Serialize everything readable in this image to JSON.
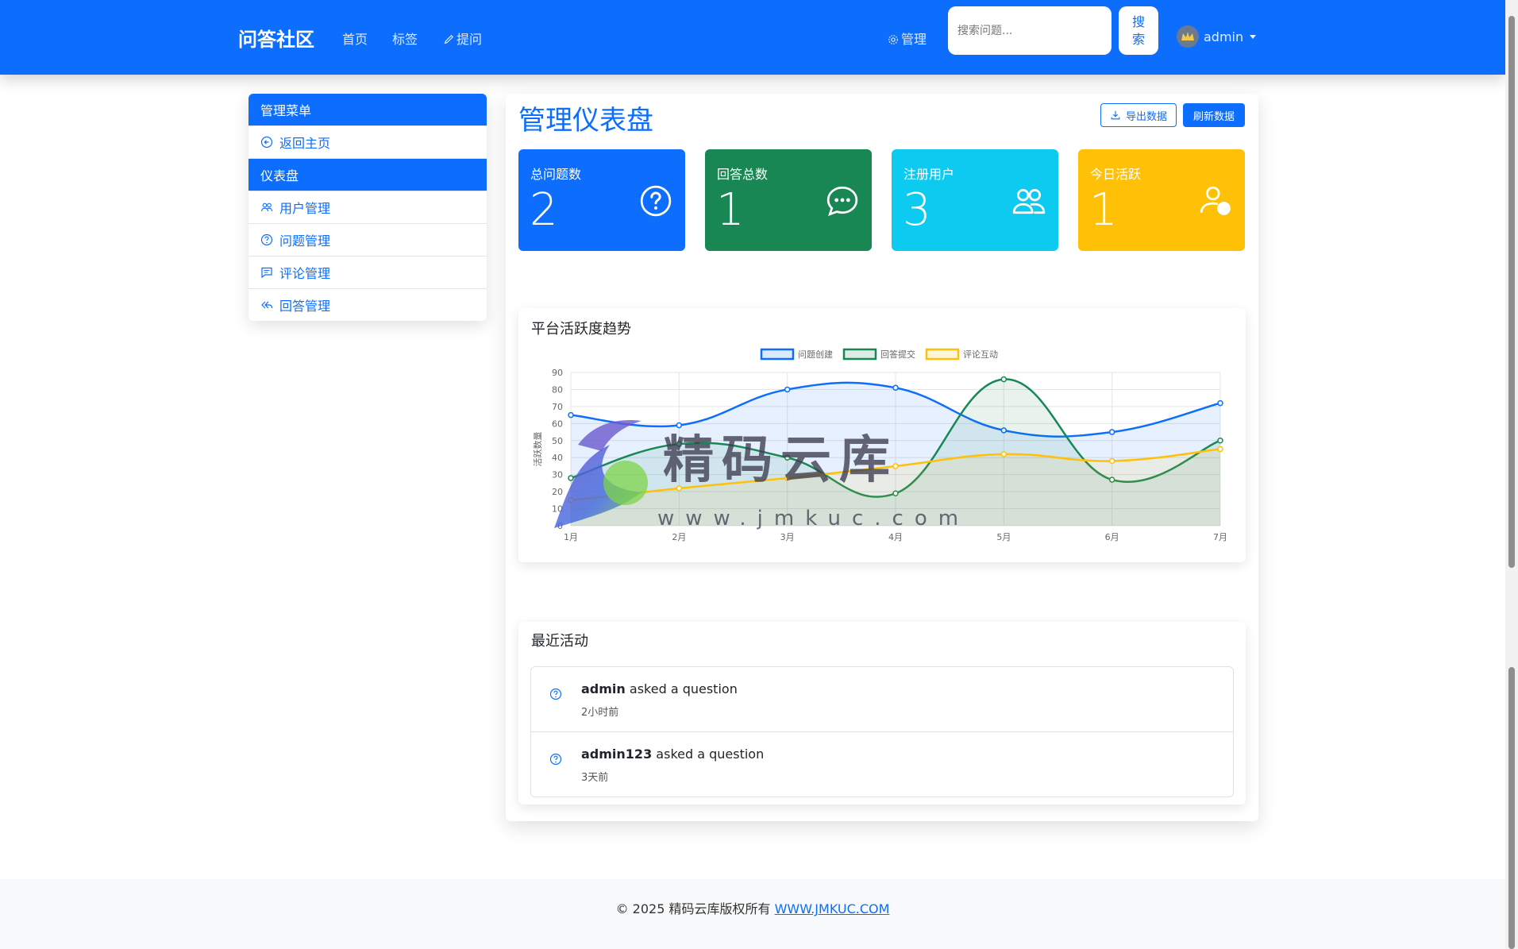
{
  "navbar": {
    "brand": "问答社区",
    "links": [
      "首页",
      "标签",
      "提问"
    ],
    "admin_link": "管理",
    "search_placeholder": "搜索问题...",
    "search_button": "搜索",
    "user": "admin"
  },
  "sidebar": {
    "header": "管理菜单",
    "items": [
      {
        "label": "返回主页",
        "icon": "arrow-left-circle-icon"
      },
      {
        "label": "仪表盘",
        "icon": "",
        "active": true
      },
      {
        "label": "用户管理",
        "icon": "people-icon"
      },
      {
        "label": "问题管理",
        "icon": "question-circle-icon"
      },
      {
        "label": "评论管理",
        "icon": "chat-square-icon"
      },
      {
        "label": "回答管理",
        "icon": "reply-all-icon"
      }
    ]
  },
  "main": {
    "title": "管理仪表盘",
    "export_button": "导出数据",
    "refresh_button": "刷新数据",
    "stats": [
      {
        "label": "总问题数",
        "value": "2",
        "color": "#0d6efd",
        "icon": "question-circle-icon"
      },
      {
        "label": "回答总数",
        "value": "1",
        "color": "#198754",
        "icon": "chat-dots-icon"
      },
      {
        "label": "注册用户",
        "value": "3",
        "color": "#0dcaf0",
        "icon": "people-icon"
      },
      {
        "label": "今日活跃",
        "value": "1",
        "color": "#ffc107",
        "icon": "person-check-icon"
      }
    ],
    "chart_title": "平台活跃度趋势",
    "activity_title": "最近活动",
    "activities": [
      {
        "user": "admin",
        "text": "asked a question",
        "time": "2小时前"
      },
      {
        "user": "admin123",
        "text": "asked a question",
        "time": "3天前"
      }
    ]
  },
  "chart_data": {
    "type": "line",
    "categories": [
      "1月",
      "2月",
      "3月",
      "4月",
      "5月",
      "6月",
      "7月"
    ],
    "series": [
      {
        "name": "问题创建",
        "color": "#0d6efd",
        "values": [
          65,
          59,
          80,
          81,
          56,
          55,
          72
        ]
      },
      {
        "name": "回答提交",
        "color": "#198754",
        "values": [
          28,
          48,
          40,
          19,
          86,
          27,
          50
        ]
      },
      {
        "name": "评论互动",
        "color": "#ffc107",
        "values": [
          15,
          22,
          28,
          35,
          42,
          38,
          45
        ]
      }
    ],
    "ylabel": "活跃数量",
    "ylim": [
      0,
      90
    ],
    "yticks": [
      0,
      10,
      20,
      30,
      40,
      50,
      60,
      70,
      80,
      90
    ],
    "legend": "top",
    "grid": true
  },
  "footer": {
    "copyright": "© 2025 精码云库版权所有",
    "link": "WWW.JMKUC.COM"
  },
  "watermark": {
    "title": "精码云库",
    "url": "www.jmkuc.com"
  }
}
